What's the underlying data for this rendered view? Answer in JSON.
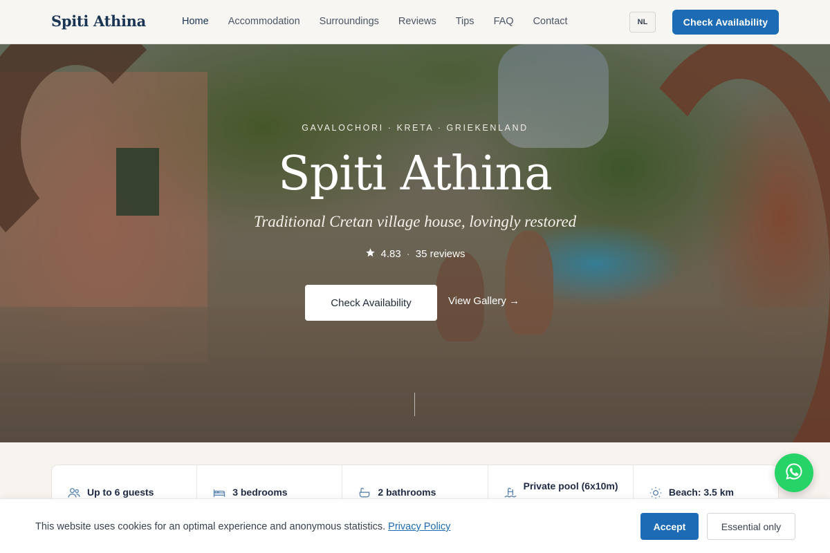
{
  "header": {
    "logo": "Spiti Athina",
    "nav": [
      "Home",
      "Accommodation",
      "Surroundings",
      "Reviews",
      "Tips",
      "FAQ",
      "Contact"
    ],
    "lang": "NL",
    "cta": "Check Availability"
  },
  "hero": {
    "eyebrow": "GAVALOCHORI · KRETA · GRIEKENLAND",
    "title": "Spiti Athina",
    "subtitle": "Traditional Cretan village house, lovingly restored",
    "rating": "4.83",
    "reviews": "35 reviews",
    "primary_button": "Check Availability",
    "secondary_button": "View Gallery →"
  },
  "features": [
    {
      "icon": "guests-icon",
      "label": "Up to 6 guests"
    },
    {
      "icon": "bed-icon",
      "label": "3 bedrooms"
    },
    {
      "icon": "bath-icon",
      "label": "2 bathrooms"
    },
    {
      "icon": "pool-icon",
      "label": "Private pool (6x10m)"
    },
    {
      "icon": "sun-icon",
      "label": "Beach: 3.5 km"
    }
  ],
  "cookie": {
    "text": "This website uses cookies for an optimal experience and anonymous statistics.",
    "link": "Privacy Policy",
    "accept": "Accept",
    "essential": "Essential only"
  },
  "colors": {
    "primary": "#1d6bb4",
    "navy": "#1a3553",
    "whatsapp": "#25d366"
  }
}
